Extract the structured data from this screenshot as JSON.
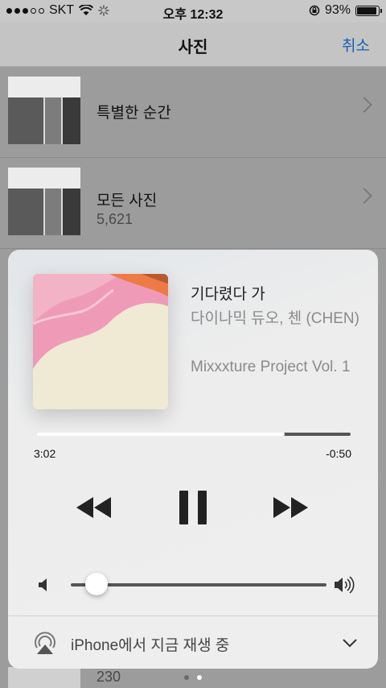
{
  "status_bar": {
    "carrier": "SKT",
    "time": "오후 12:32",
    "battery_percent": "93%",
    "battery_level": 0.93
  },
  "nav": {
    "title": "사진",
    "cancel": "취소"
  },
  "albums": [
    {
      "title": "특별한 순간",
      "count": ""
    },
    {
      "title": "모든 사진",
      "count": "5,621"
    }
  ],
  "partial_count": "230",
  "page_indicator": {
    "count": 2,
    "current": 2
  },
  "now_playing": {
    "title": "기다렸다 가",
    "artist": "다이나믹 듀오, 첸 (CHEN)",
    "album": "Mixxxture Project Vol. 1",
    "elapsed": "3:02",
    "remaining": "-0:50",
    "progress": 0.79,
    "volume": 0.1,
    "output": "iPhone에서 지금 재생 중"
  },
  "icons": [
    "wifi-icon",
    "activity-spinner-icon",
    "rotation-lock-icon",
    "battery-icon",
    "chevron-right-icon",
    "rewind-icon",
    "pause-icon",
    "fast-forward-icon",
    "volume-min-icon",
    "volume-max-icon",
    "airplay-icon",
    "chevron-down-icon"
  ],
  "colors": {
    "accent": "#1760b5"
  }
}
